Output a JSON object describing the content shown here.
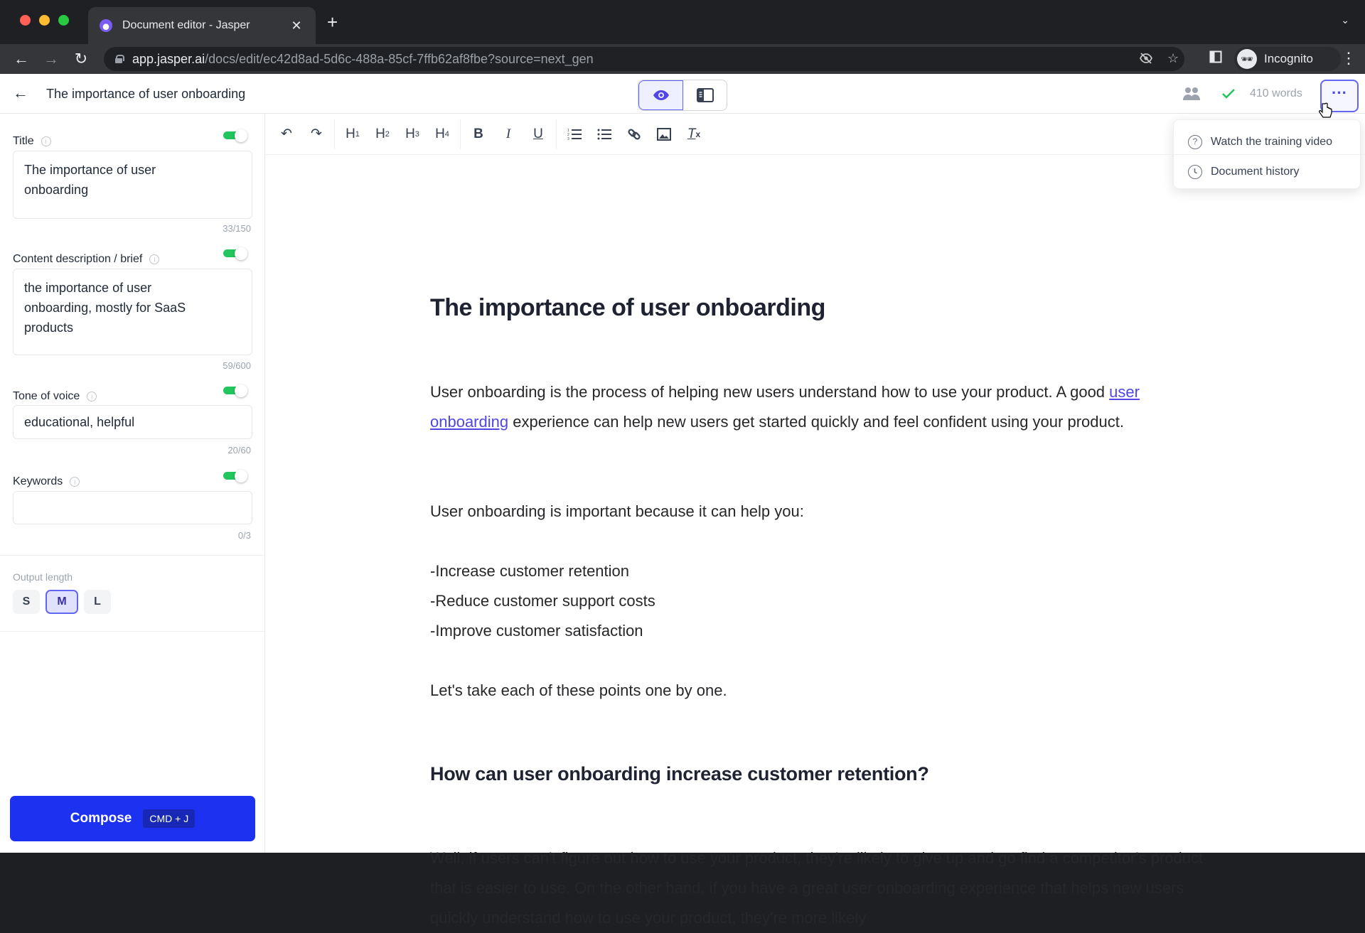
{
  "browser": {
    "tab_title": "Document editor - Jasper",
    "url_host": "app.jasper.ai",
    "url_path": "/docs/edit/ec42d8ad-5d6c-488a-85cf-7ffb62af8fbe?source=next_gen",
    "profile_label": "Incognito"
  },
  "header": {
    "doc_title": "The importance of user onboarding",
    "word_count": "410 words",
    "more_label": "···",
    "view_modes": [
      "preview",
      "sidebar-layout"
    ],
    "active_view": "preview"
  },
  "menu": {
    "items": [
      {
        "label": "Watch the training video",
        "icon": "question-circle-icon"
      },
      {
        "label": "Document history",
        "icon": "clock-icon"
      }
    ]
  },
  "sidebar": {
    "title": {
      "label": "Title",
      "value": "The importance of user\nonboarding",
      "counter": "33/150",
      "enabled": true
    },
    "brief": {
      "label": "Content description / brief",
      "value": "the importance of user\nonboarding, mostly for SaaS\nproducts",
      "counter": "59/600",
      "enabled": true
    },
    "tone": {
      "label": "Tone of voice",
      "value": "educational, helpful",
      "counter": "20/60",
      "enabled": true
    },
    "keywords": {
      "label": "Keywords",
      "value": "",
      "counter": "0/3",
      "enabled": true
    },
    "output_length": {
      "label": "Output length",
      "options": [
        "S",
        "M",
        "L"
      ],
      "selected": "M"
    },
    "compose": {
      "label": "Compose",
      "shortcut": "CMD + J"
    }
  },
  "toolbar": {
    "undo": "↶",
    "redo": "↷",
    "h1": "H",
    "h2": "H",
    "h3": "H",
    "h4": "H",
    "h1_sub": "1",
    "h2_sub": "2",
    "h3_sub": "3",
    "h4_sub": "4",
    "bold": "B",
    "italic": "I",
    "underline": "U",
    "ol": "≡",
    "ul": "≡",
    "link": "🔗",
    "image": "▣",
    "clear": "T"
  },
  "document": {
    "h1": "The importance of user onboarding",
    "p1_before": "User onboarding is the process of helping new users understand how to use your product. A good ",
    "p1_link": "user onboarding",
    "p1_after": " experience can help new users get started quickly and feel confident using your product.",
    "p2": "User onboarding is important because it can help you:",
    "list": [
      "-Increase customer retention",
      "-Reduce customer support costs",
      "-Improve customer satisfaction"
    ],
    "p3": "Let's take each of these points one by one.",
    "h2": "How can user onboarding increase customer retention?",
    "p4": "Well, if users can't figure out how to use your product, they're likely to give up and go find a competitor's product that is easier to use. On the other hand, if you have a great user onboarding experience that helps new users quickly understand how to use your product, they're more likely"
  },
  "colors": {
    "accent": "#6366f1",
    "compose": "#1d32f0",
    "toggle_on": "#22c55e",
    "link": "#4f46e5"
  }
}
